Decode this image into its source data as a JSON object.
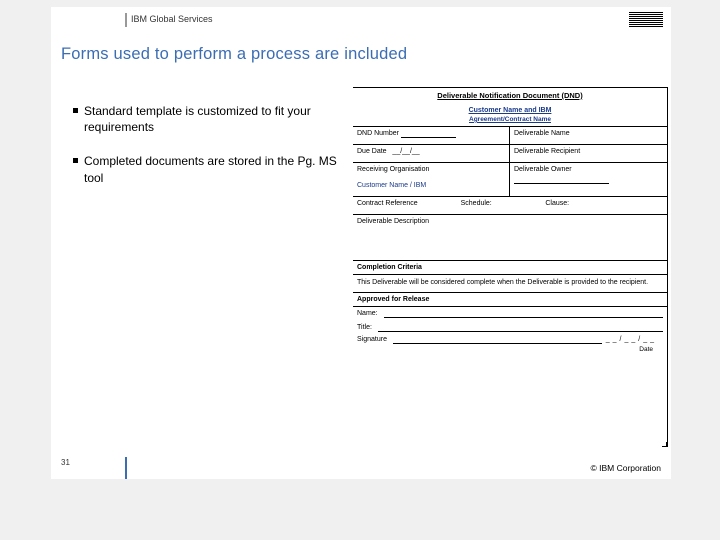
{
  "header": {
    "brand": "IBM Global Services"
  },
  "title": "Forms used to perform a process are included",
  "bullets": [
    "Standard template is customized to fit your requirements",
    "Completed documents are stored in the Pg. MS tool"
  ],
  "form": {
    "title": "Deliverable Notification Document (DND)",
    "sub": "Customer Name and IBM",
    "sub2": "Agreement/Contract Name",
    "dnd_number_label": "DND Number",
    "deliverable_name_label": "Deliverable Name",
    "due_date_label": "Due Date",
    "date_sep": "__/__/__",
    "deliverable_recipient_label": "Deliverable Recipient",
    "receiving_org_label": "Receiving Organisation",
    "receiving_org_value": "Customer Name / IBM",
    "deliverable_owner_label": "Deliverable Owner",
    "contract_ref_label": "Contract Reference",
    "schedule_label": "Schedule:",
    "clause_label": "Clause:",
    "deliverable_desc_label": "Deliverable Description",
    "completion_head": "Completion Criteria",
    "completion_text": "This Deliverable will be considered complete when the Deliverable is provided to the recipient.",
    "approved_head": "Approved for Release",
    "name_label": "Name:",
    "title_label": "Title:",
    "signature_label": "Signature",
    "sig_date_sep": "__/__/__",
    "date_label": "Date"
  },
  "footer": {
    "page": "31",
    "copyright": "© IBM Corporation"
  }
}
